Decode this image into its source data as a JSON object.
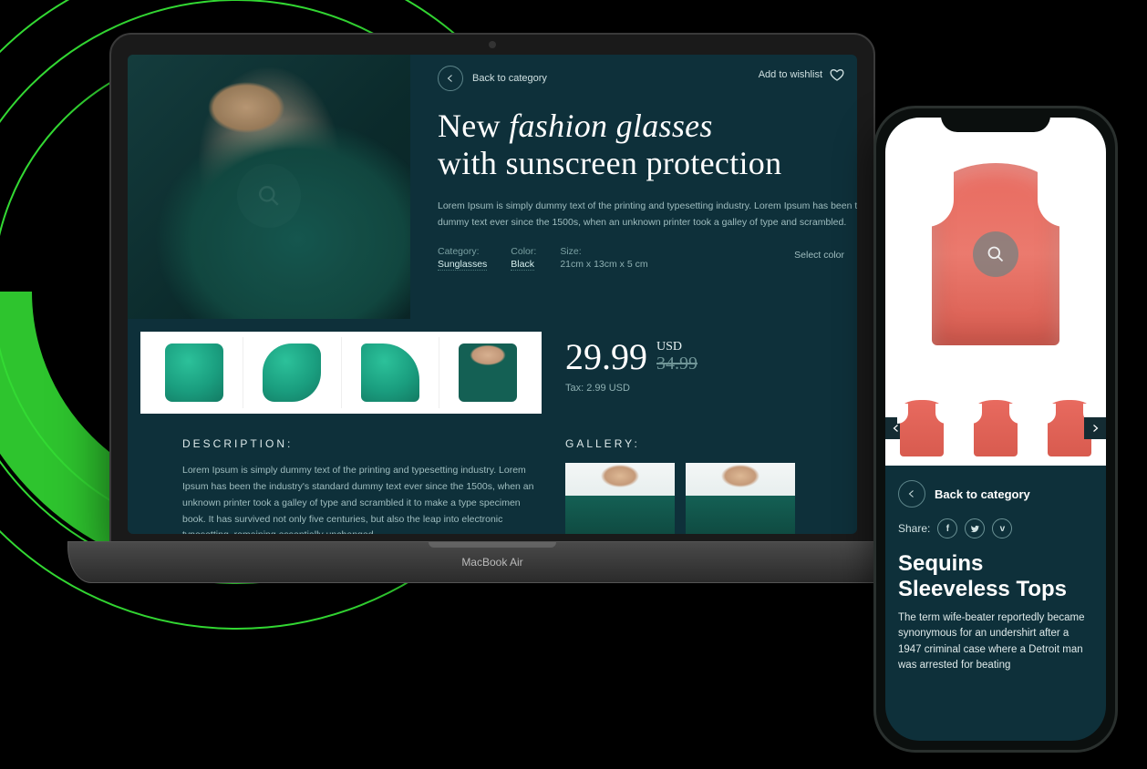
{
  "decor": {
    "accent": "#33d933"
  },
  "laptop_model_label": "MacBook Air",
  "laptop": {
    "back_label": "Back to category",
    "wishlist_label": "Add to wishlist",
    "title_part1": "New ",
    "title_italic": "fashion glasses",
    "title_part2": "with sunscreen protection",
    "blurb": "Lorem Ipsum is simply dummy text of the printing and typesetting industry. Lorem Ipsum has been the dummy text ever since the 1500s, when an unknown printer took a galley of type and scrambled.",
    "specs": {
      "category_label": "Category:",
      "category_value": "Sunglasses",
      "color_label": "Color:",
      "color_value": "Black",
      "size_label": "Size:",
      "size_value": "21cm x 13cm x 5 cm"
    },
    "select_color_label": "Select color",
    "price": {
      "now": "29.99",
      "currency": "USD",
      "was": "34.99"
    },
    "tax_line": "Tax: 2.99 USD",
    "description_heading": "DESCRIPTION:",
    "description_body": "Lorem Ipsum is simply dummy text of the printing and typesetting industry. Lorem Ipsum has been the industry's standard dummy text ever since the 1500s, when an unknown printer took a galley of type and scrambled it to make a type specimen book. It has survived not only five centuries, but also the leap into electronic typesetting, remaining essentially unchanged.",
    "gallery_heading": "GALLERY:"
  },
  "phone": {
    "back_label": "Back to category",
    "share_label": "Share:",
    "title": "Sequins Sleeveless Tops",
    "description": "The term wife-beater reportedly became synonymous for an undershirt after a 1947 criminal case where a Detroit man was arrested for beating"
  }
}
